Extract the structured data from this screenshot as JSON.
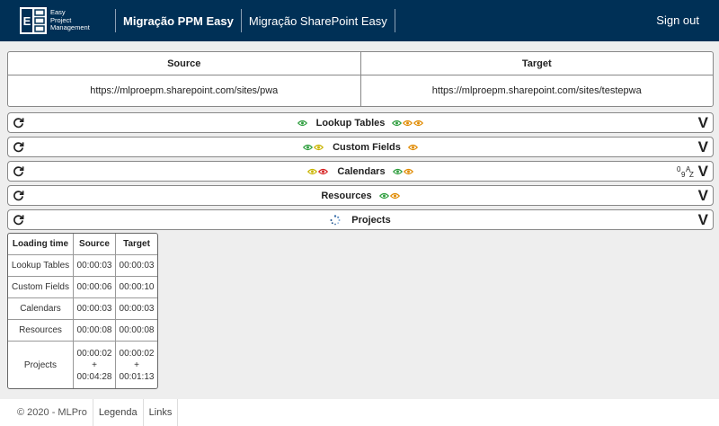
{
  "header": {
    "logo_lines": [
      "Easy",
      "Project",
      "Management"
    ],
    "brand": "Migração PPM Easy",
    "nav_link": "Migração SharePoint Easy",
    "signout": "Sign out"
  },
  "source_target": {
    "source_label": "Source",
    "target_label": "Target",
    "source_url": "https://mlproepm.sharepoint.com/sites/pwa",
    "target_url": "https://mlproepm.sharepoint.com/sites/testepwa"
  },
  "panels": [
    {
      "title": "Lookup Tables",
      "left_eyes": [
        "#2e9e3e"
      ],
      "right_eyes": [
        "#2e9e3e",
        "#e08a00",
        "#e08a00"
      ]
    },
    {
      "title": "Custom Fields",
      "left_eyes": [
        "#2e9e3e",
        "#c9b400"
      ],
      "right_eyes": [
        "#e08a00"
      ]
    },
    {
      "title": "Calendars",
      "left_eyes": [
        "#c9b400",
        "#d62020"
      ],
      "right_eyes": [
        "#2e9e3e",
        "#e08a00"
      ]
    },
    {
      "title": "Resources",
      "left_eyes": [],
      "right_eyes": [
        "#2e9e3e",
        "#e08a00"
      ]
    },
    {
      "title": "Projects",
      "left_eyes": [],
      "right_eyes": []
    }
  ],
  "sort_icon": {
    "a": "0",
    "b": "9",
    "c": "A",
    "d": "Z"
  },
  "chevron": "V",
  "loading_table": {
    "headers": [
      "Loading time",
      "Source",
      "Target"
    ],
    "rows": [
      {
        "label": "Lookup Tables",
        "source": "00:00:03",
        "target": "00:00:03"
      },
      {
        "label": "Custom Fields",
        "source": "00:00:06",
        "target": "00:00:10"
      },
      {
        "label": "Calendars",
        "source": "00:00:03",
        "target": "00:00:03"
      },
      {
        "label": "Resources",
        "source": "00:00:08",
        "target": "00:00:08"
      }
    ],
    "projects": {
      "label": "Projects",
      "source": [
        "00:00:02",
        "+",
        "00:04:28"
      ],
      "target": [
        "00:00:02",
        "+",
        "00:01:13"
      ]
    }
  },
  "footer": {
    "copyright": "© 2020 - MLPro",
    "links": [
      "Legenda",
      "Links"
    ]
  }
}
